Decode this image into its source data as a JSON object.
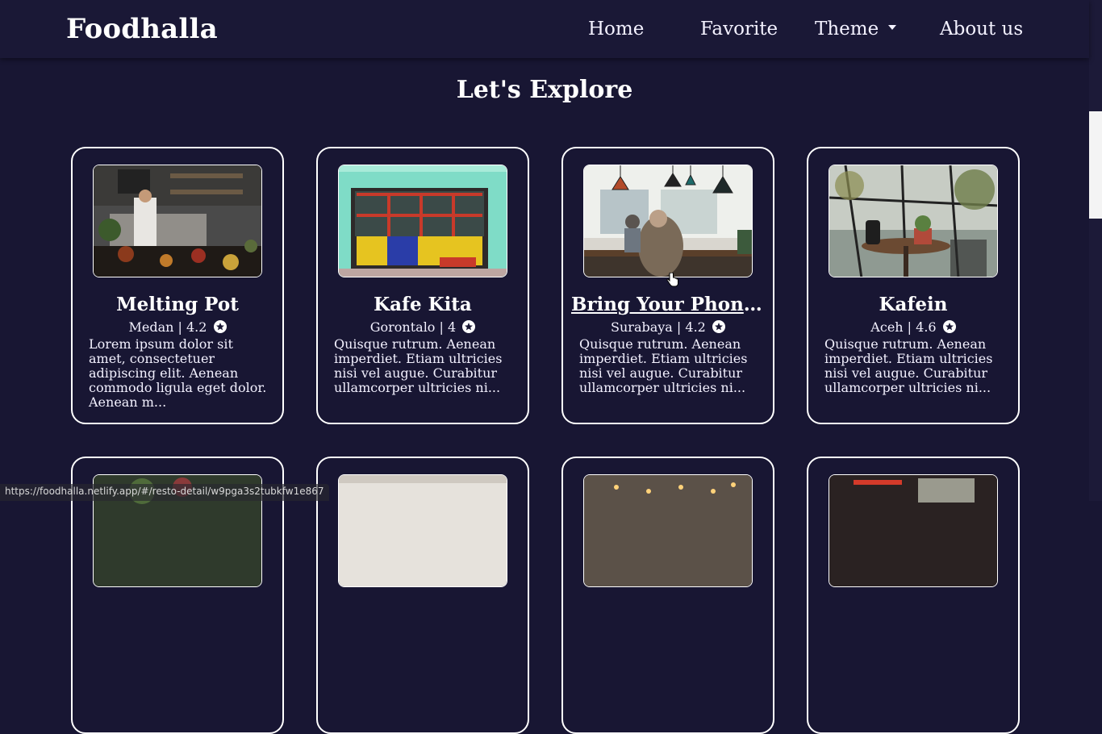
{
  "navbar": {
    "brand": "Foodhalla",
    "links": [
      {
        "label": "Home"
      },
      {
        "label": "Favorite"
      },
      {
        "label": "Theme"
      },
      {
        "label": "About us"
      }
    ]
  },
  "page": {
    "title": "Let's Explore"
  },
  "restaurants": [
    {
      "name": "Melting Pot",
      "city": "Medan",
      "rating": "4.2",
      "description": "Lorem ipsum dolor sit amet, consectetuer adipiscing elit. Aenean commodo ligula eget dolor. Aenean m..."
    },
    {
      "name": "Kafe Kita",
      "city": "Gorontalo",
      "rating": "4",
      "description": "Quisque rutrum. Aenean imperdiet. Etiam ultricies nisi vel augue. Curabitur ullamcorper ultricies ni..."
    },
    {
      "name": "Bring Your Phone Cafe",
      "city": "Surabaya",
      "rating": "4.2",
      "description": "Quisque rutrum. Aenean imperdiet. Etiam ultricies nisi vel augue. Curabitur ullamcorper ultricies ni..."
    },
    {
      "name": "Kafein",
      "city": "Aceh",
      "rating": "4.6",
      "description": "Quisque rutrum. Aenean imperdiet. Etiam ultricies nisi vel augue. Curabitur ullamcorper ultricies ni..."
    }
  ],
  "status_bar": {
    "url": "https://foodhalla.netlify.app/#/resto-detail/w9pga3s2tubkfw1e867"
  },
  "colors": {
    "background": "#181633",
    "navbar": "#1a1836",
    "text": "#ffffff"
  }
}
